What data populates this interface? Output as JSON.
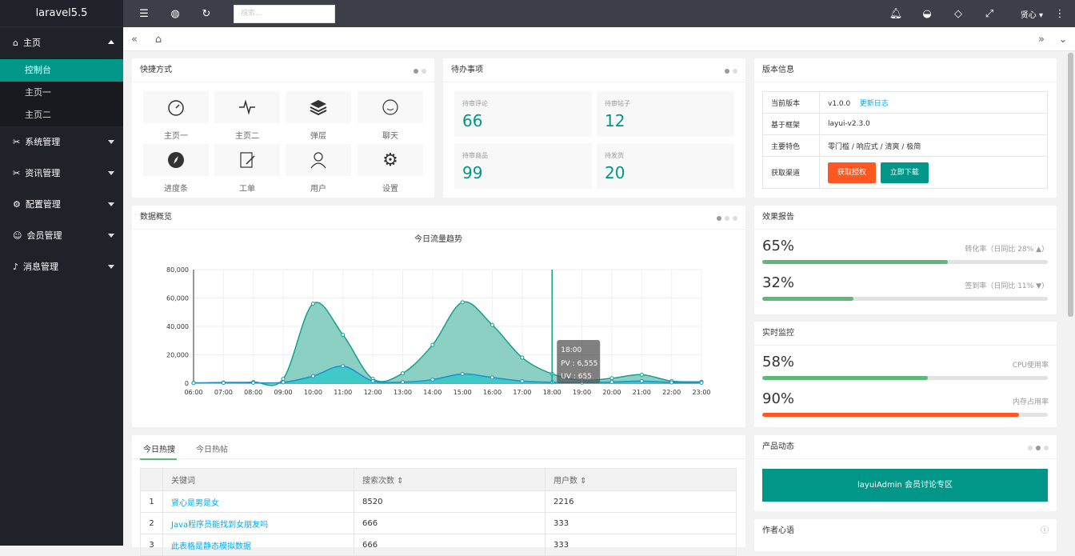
{
  "app": {
    "title": "laravel5.5"
  },
  "sidebar": {
    "main": "主页",
    "sub": [
      "控制台",
      "主页一",
      "主页二"
    ],
    "groups": [
      "系统管理",
      "资讯管理",
      "配置管理",
      "会员管理",
      "消息管理"
    ]
  },
  "topbar": {
    "search_placeholder": "搜索...",
    "user": "贤心"
  },
  "quick": {
    "title": "快捷方式",
    "items": [
      "主页一",
      "主页二",
      "弹层",
      "聊天",
      "进度条",
      "工单",
      "用户",
      "设置"
    ]
  },
  "todo": {
    "title": "待办事项",
    "items": [
      {
        "label": "待审评论",
        "value": "66"
      },
      {
        "label": "待审帖子",
        "value": "12"
      },
      {
        "label": "待审商品",
        "value": "99"
      },
      {
        "label": "待发货",
        "value": "20"
      }
    ]
  },
  "version": {
    "title": "版本信息",
    "rows": [
      [
        "当前版本",
        "v1.0.0"
      ],
      [
        "基于框架",
        "layui-v2.3.0"
      ],
      [
        "主要特色",
        "零门槛 / 响应式 / 清爽 / 极简"
      ],
      [
        "获取渠道",
        ""
      ]
    ],
    "changelog": "更新日志",
    "btn_auth": "获取授权",
    "btn_download": "立即下载"
  },
  "overview": {
    "title": "数据概览"
  },
  "chart_data": {
    "type": "area",
    "title": "今日流量趋势",
    "categories": [
      "06:00",
      "07:00",
      "08:00",
      "09:00",
      "10:00",
      "11:00",
      "12:00",
      "13:00",
      "14:00",
      "15:00",
      "16:00",
      "17:00",
      "18:00",
      "19:00",
      "20:00",
      "21:00",
      "22:00",
      "23:00"
    ],
    "y_ticks": [
      "0",
      "20,000",
      "40,000",
      "60,000",
      "80,000"
    ],
    "ylim": [
      0,
      80000
    ],
    "series": [
      {
        "name": "PV",
        "values": [
          200,
          500,
          800,
          3000,
          56000,
          34000,
          3000,
          7000,
          27000,
          57000,
          41000,
          18000,
          6555,
          2000,
          3500,
          6000,
          1500,
          1000
        ],
        "color": "#7fcabd"
      },
      {
        "name": "UV",
        "values": [
          100,
          200,
          300,
          600,
          5000,
          12000,
          1500,
          800,
          2500,
          6500,
          4000,
          1500,
          655,
          400,
          800,
          1500,
          500,
          300
        ],
        "color": "#2ec7c9"
      }
    ],
    "tooltip": {
      "x": "18:00",
      "pv": "PV : 6,555",
      "uv": "UV : 655"
    }
  },
  "report": {
    "title": "效果报告",
    "items": [
      {
        "percent": "65%",
        "note": "转化率（日同比 28% ▲）",
        "value": 65,
        "color": "#5FB878"
      },
      {
        "percent": "32%",
        "note": "签到率（日同比 11% ▼）",
        "value": 32,
        "color": "#5FB878"
      }
    ]
  },
  "monitor": {
    "title": "实时监控",
    "items": [
      {
        "percent": "58%",
        "note": "CPU使用率",
        "value": 58,
        "color": "#5FB878"
      },
      {
        "percent": "90%",
        "note": "内存占用率",
        "value": 90,
        "color": "#FF5722"
      }
    ]
  },
  "hot": {
    "tabs": [
      "今日热搜",
      "今日热帖"
    ],
    "headers": [
      "关键词",
      "搜索次数",
      "用户数"
    ],
    "rows": [
      [
        "1",
        "贤心是男是女",
        "8520",
        "2216"
      ],
      [
        "2",
        "Java程序员能找到女朋友吗",
        "666",
        "333"
      ],
      [
        "3",
        "此表格是静态模拟数据",
        "666",
        "333"
      ]
    ]
  },
  "product": {
    "title": "产品动态",
    "banner": "layuiAdmin 会员讨论专区"
  },
  "author": {
    "title": "作者心语"
  }
}
